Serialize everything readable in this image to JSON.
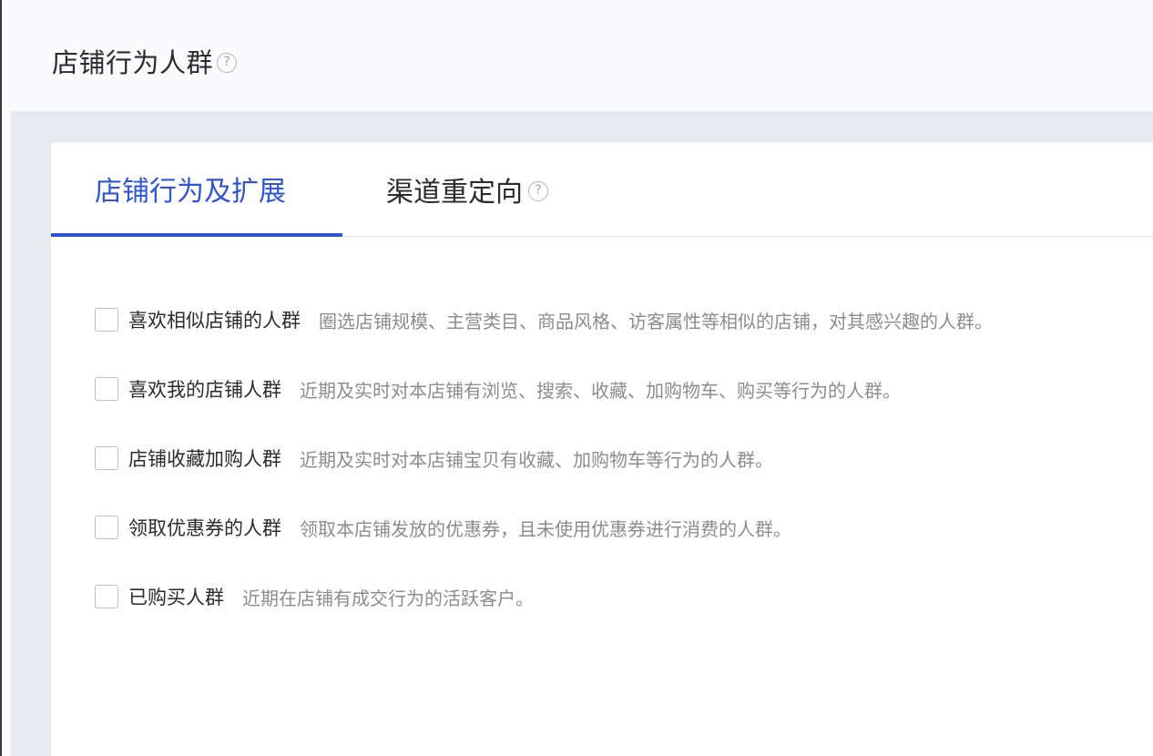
{
  "header": {
    "title": "店铺行为人群",
    "help_glyph": "?"
  },
  "tabs": [
    {
      "label": "店铺行为及扩展",
      "active": true
    },
    {
      "label": "渠道重定向",
      "active": false,
      "help_glyph": "?"
    }
  ],
  "options": [
    {
      "label": "喜欢相似店铺的人群",
      "desc": "圈选店铺规模、主营类目、商品风格、访客属性等相似的店铺，对其感兴趣的人群。",
      "checked": false
    },
    {
      "label": "喜欢我的店铺人群",
      "desc": "近期及实时对本店铺有浏览、搜索、收藏、加购物车、购买等行为的人群。",
      "checked": false
    },
    {
      "label": "店铺收藏加购人群",
      "desc": "近期及实时对本店铺宝贝有收藏、加购物车等行为的人群。",
      "checked": false
    },
    {
      "label": "领取优惠券的人群",
      "desc": "领取本店铺发放的优惠券，且未使用优惠券进行消费的人群。",
      "checked": false
    },
    {
      "label": "已购买人群",
      "desc": "近期在店铺有成交行为的活跃客户。",
      "checked": false
    }
  ],
  "colors": {
    "accent": "#2f55d4",
    "text": "#2b2b2b",
    "muted": "#8c8c8c",
    "band": "#e8e9f0"
  },
  "icons": {
    "help": "question-circle-icon",
    "checkbox": "checkbox-icon"
  }
}
